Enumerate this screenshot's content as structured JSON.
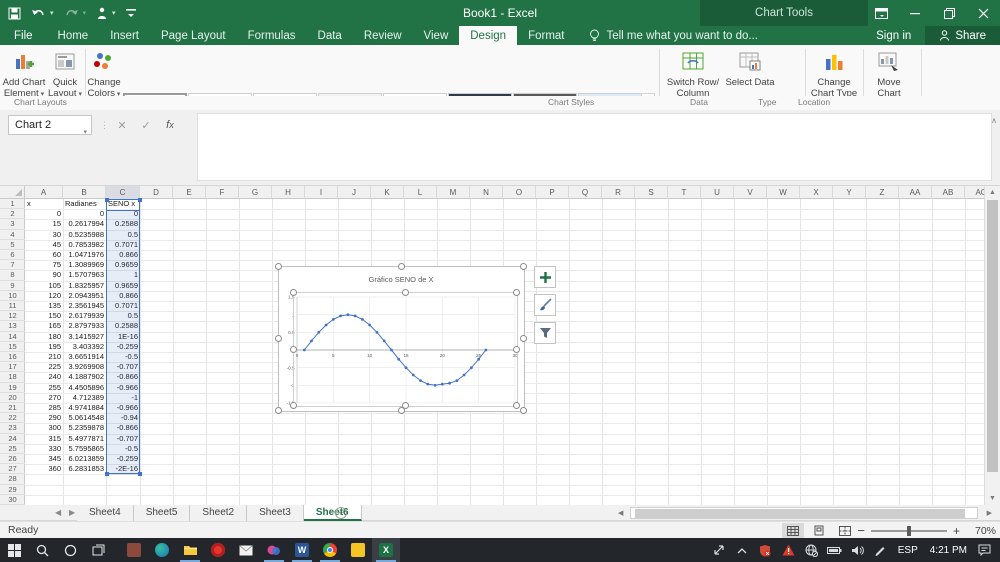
{
  "title_bar": {
    "title": "Book1 - Excel",
    "context_label": "Chart Tools"
  },
  "ribbon": {
    "tabs": [
      "File",
      "Home",
      "Insert",
      "Page Layout",
      "Formulas",
      "Data",
      "Review",
      "View",
      "Design",
      "Format"
    ],
    "active_tab": "Design",
    "tell_me": "Tell me what you want to do...",
    "sign_in": "Sign in",
    "share": "Share",
    "chart_layouts": {
      "label": "Chart Layouts",
      "add_chart_element": "Add Chart Element",
      "quick_layout": "Quick Layout"
    },
    "chart_styles": {
      "label": "Chart Styles",
      "change_colors": "Change Colors",
      "style_count": 8,
      "selected_style": 1
    },
    "data_group": {
      "label": "Data",
      "switch_row_column": "Switch Row/ Column",
      "select_data": "Select Data"
    },
    "type_group": {
      "label": "Type",
      "change_chart_type": "Change Chart Type"
    },
    "location_group": {
      "label": "Location",
      "move_chart": "Move Chart"
    },
    "collapse_icon": "^"
  },
  "formula_bar": {
    "name_box": "Chart 2",
    "formula": ""
  },
  "grid": {
    "column_headers": [
      "A",
      "B",
      "C",
      "D",
      "E",
      "F",
      "G",
      "H",
      "I",
      "J",
      "K",
      "L",
      "M",
      "N",
      "O",
      "P",
      "Q",
      "R",
      "S",
      "T",
      "U",
      "V",
      "W",
      "X",
      "Y",
      "Z",
      "AA",
      "AB",
      "AC"
    ],
    "header_row": [
      "x",
      "Radianes",
      "SENO x"
    ],
    "rows": [
      [
        "0",
        "0",
        "0"
      ],
      [
        "15",
        "0.2617994",
        "0.2588"
      ],
      [
        "30",
        "0.5235988",
        "0.5"
      ],
      [
        "45",
        "0.7853982",
        "0.7071"
      ],
      [
        "60",
        "1.0471976",
        "0.866"
      ],
      [
        "75",
        "1.3089969",
        "0.9659"
      ],
      [
        "90",
        "1.5707963",
        "1"
      ],
      [
        "105",
        "1.8325957",
        "0.9659"
      ],
      [
        "120",
        "2.0943951",
        "0.866"
      ],
      [
        "135",
        "2.3561945",
        "0.7071"
      ],
      [
        "150",
        "2.6179939",
        "0.5"
      ],
      [
        "165",
        "2.8797933",
        "0.2588"
      ],
      [
        "180",
        "3.1415927",
        "1E-16"
      ],
      [
        "195",
        "3.403392",
        "-0.259"
      ],
      [
        "210",
        "3.6651914",
        "-0.5"
      ],
      [
        "225",
        "3.9269908",
        "-0.707"
      ],
      [
        "240",
        "4.1887902",
        "-0.866"
      ],
      [
        "255",
        "4.4505896",
        "-0.966"
      ],
      [
        "270",
        "4.712389",
        "-1"
      ],
      [
        "285",
        "4.9741884",
        "-0.966"
      ],
      [
        "290",
        "5.0614548",
        "-0.94"
      ],
      [
        "300",
        "5.2359878",
        "-0.866"
      ],
      [
        "315",
        "5.4977871",
        "-0.707"
      ],
      [
        "330",
        "5.7595865",
        "-0.5"
      ],
      [
        "345",
        "6.0213859",
        "-0.259"
      ],
      [
        "360",
        "6.2831853",
        "-2E-16"
      ]
    ],
    "visible_row_count": 30
  },
  "chart_data": {
    "type": "line",
    "title": "Gráfico SENO de X",
    "x": [
      1,
      2,
      3,
      4,
      5,
      6,
      7,
      8,
      9,
      10,
      11,
      12,
      13,
      14,
      15,
      16,
      17,
      18,
      19,
      20,
      21,
      22,
      23,
      24,
      25,
      26
    ],
    "y": [
      0,
      0.2588,
      0.5,
      0.7071,
      0.866,
      0.9659,
      1,
      0.9659,
      0.866,
      0.7071,
      0.5,
      0.2588,
      1e-16,
      -0.259,
      -0.5,
      -0.707,
      -0.866,
      -0.966,
      -1,
      -0.966,
      -0.94,
      -0.866,
      -0.707,
      -0.5,
      -0.259,
      -2e-16
    ],
    "x_ticks": [
      0,
      5,
      10,
      15,
      20,
      25,
      30
    ],
    "y_ticks": [
      1.5,
      1,
      0.5,
      0,
      -0.5,
      -1,
      -1.5
    ],
    "xlim": [
      0,
      30
    ],
    "ylim": [
      -1.5,
      1.5
    ],
    "grid": true,
    "legend": false,
    "line_color": "#4472c4"
  },
  "sheet_tabs": {
    "tabs": [
      "Sheet4",
      "Sheet5",
      "Sheet2",
      "Sheet3",
      "Sheet6"
    ],
    "active": "Sheet6",
    "add_label": "+"
  },
  "status_bar": {
    "status": "Ready",
    "zoom_level": "70%"
  },
  "taskbar": {
    "language": "ESP",
    "time": "4:21 PM"
  },
  "colors": {
    "excel_green": "#217346",
    "accent_blue": "#4472c4",
    "selection_fill": "#dbe5f1"
  }
}
